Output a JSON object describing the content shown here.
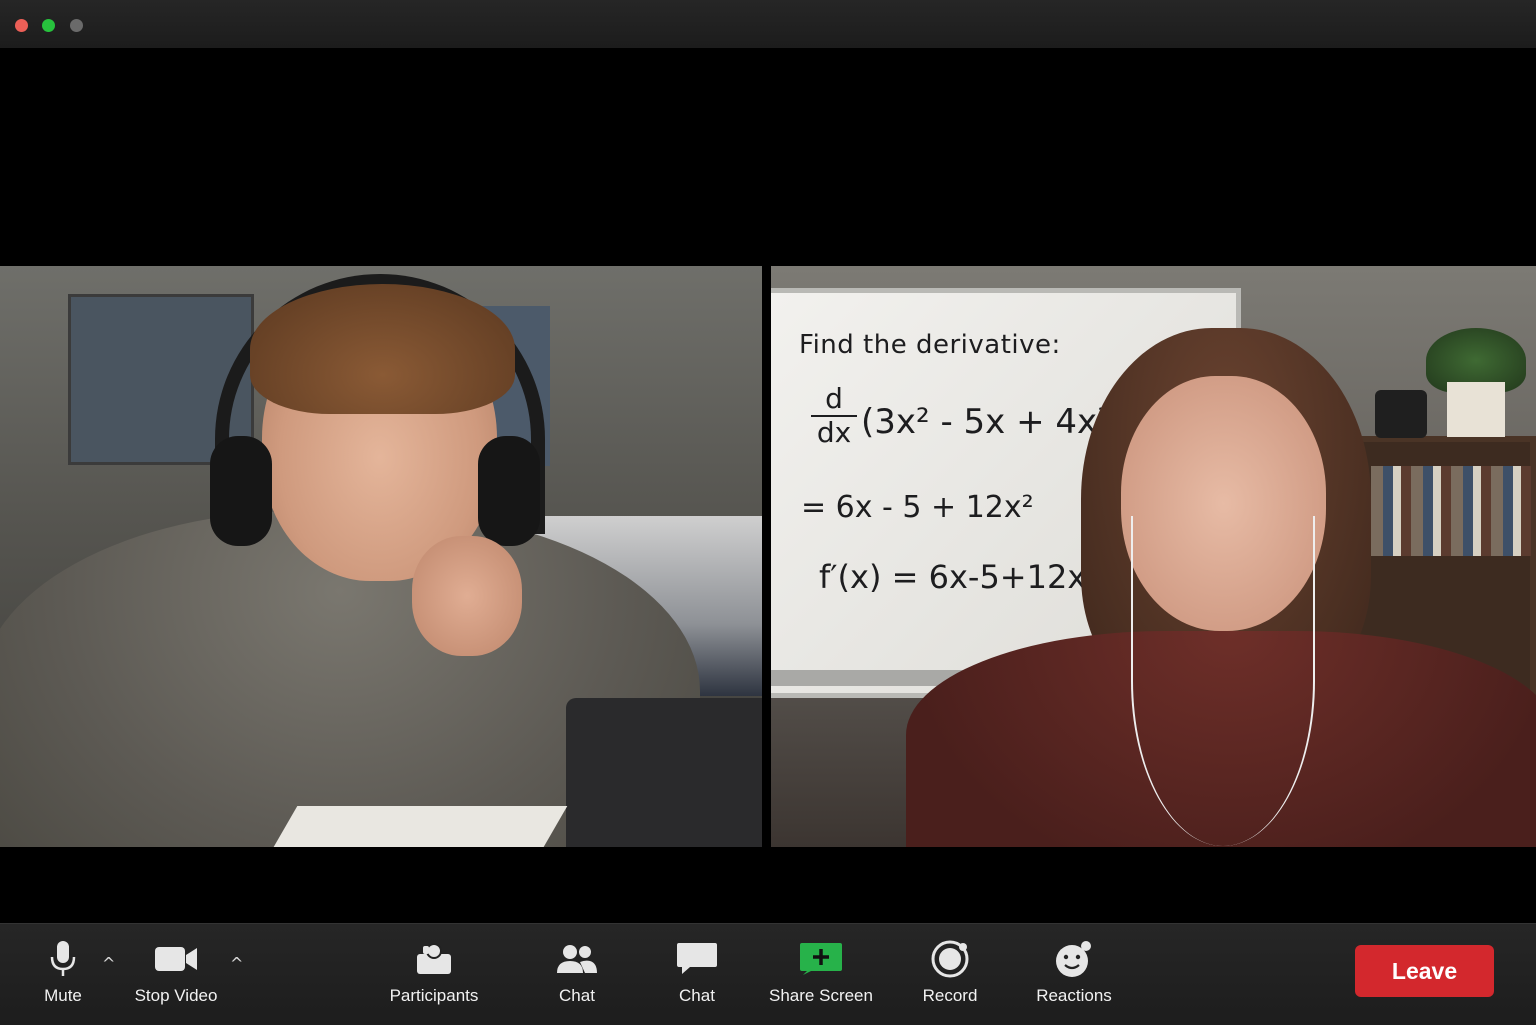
{
  "window": {
    "controls": [
      "close",
      "minimize",
      "zoom"
    ]
  },
  "whiteboard": {
    "line1": "Find the derivative:",
    "frac_num": "d",
    "frac_den": "dx",
    "expr": "(3x² - 5x + 4x³)",
    "line3": "= 6x - 5 + 12x²",
    "line4": "f′(x) = 6x-5+12x²"
  },
  "toolbar": {
    "mute": {
      "label": "Mute",
      "icon": "microphone-icon"
    },
    "mute_caret": "^",
    "stop_video": {
      "label": "Stop Video",
      "icon": "video-camera-icon"
    },
    "video_caret": "^",
    "participants": {
      "label": "Participants",
      "icon": "participants-icon"
    },
    "chat1": {
      "label": "Chat",
      "icon": "people-icon"
    },
    "chat2": {
      "label": "Chat",
      "icon": "chat-bubble-icon"
    },
    "share_screen": {
      "label": "Share Screen",
      "icon": "share-screen-icon",
      "color": "#27b24a"
    },
    "record": {
      "label": "Record",
      "icon": "record-icon"
    },
    "reactions": {
      "label": "Reactions",
      "icon": "emoji-icon"
    },
    "leave": {
      "label": "Leave",
      "color": "#d3282d"
    }
  }
}
